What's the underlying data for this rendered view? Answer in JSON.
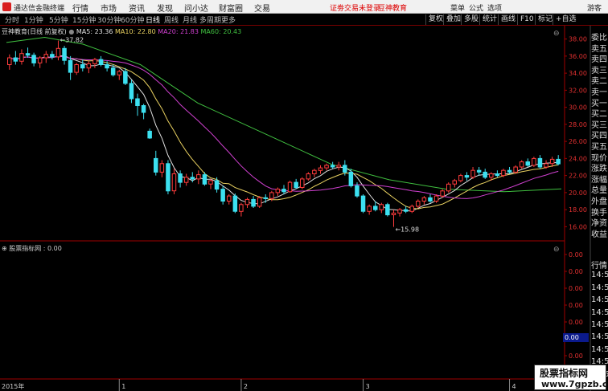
{
  "app": {
    "title": "通达信金融终端",
    "notice": "证劵交易未登录",
    "brand": "豆神教育",
    "user": "游客"
  },
  "menu": [
    "行情",
    "市场",
    "资讯",
    "发现",
    "问小达",
    "财富圈",
    "交易"
  ],
  "right_menu": [
    "菜单",
    "公式",
    "选项"
  ],
  "timeframes": [
    "分时",
    "1分钟",
    "5分钟",
    "15分钟",
    "30分钟",
    "60分钟",
    "日线",
    "周线",
    "月线",
    "多周期",
    "更多"
  ],
  "active_timeframe": "日线",
  "tools": [
    "复权",
    "叠加",
    "多股",
    "统计",
    "画线",
    "F10",
    "标记",
    "+自选"
  ],
  "chart": {
    "stock": "豆神教育(日线 前复权)",
    "ma5": "MA5: 23.36",
    "ma10": "MA10: 22.80",
    "ma20": "MA20: 21.83",
    "ma60": "MA60: 20.43",
    "high_label": "37.82",
    "low_label": "15.98",
    "indicator": "股票指标网 : 0.00",
    "year_label": "2015年",
    "months": [
      "1",
      "2",
      "3",
      "4"
    ],
    "value_box": "0.00"
  },
  "colors": {
    "up": "#ff3c3c",
    "down": "#3ce0f0",
    "ma5": "#e0e0e0",
    "ma10": "#e8d060",
    "ma20": "#d040d0",
    "ma60": "#40c040",
    "axis": "#a00000"
  },
  "right_panel": {
    "items": [
      "委比",
      "卖五",
      "卖四",
      "卖三",
      "卖二",
      "卖一",
      "买一",
      "买二",
      "买三",
      "买四",
      "买五",
      "现价",
      "涨跌",
      "涨幅",
      "总量",
      "外盘",
      "换手",
      "净资",
      "收益"
    ],
    "lower": [
      "行情",
      "14:5",
      "14:5",
      "14:5",
      "14:5",
      "14:5",
      "14:5",
      "14:5",
      "14:5",
      "14:5"
    ]
  },
  "watermark": {
    "line1": "股票指标网",
    "line2": "www.7gpzb.com"
  },
  "chart_data": {
    "type": "candlestick",
    "ylim": [
      15,
      39
    ],
    "yticks": [
      16,
      18,
      20,
      22,
      24,
      26,
      28,
      30,
      32,
      34,
      36,
      38
    ],
    "indicator_yticks": [
      "0.00",
      "0.00",
      "0.00",
      "0.00",
      "0.00",
      "0.00",
      "0.00",
      "0.00"
    ],
    "candles": [
      [
        35.0,
        36.2,
        34.4,
        35.8
      ],
      [
        35.8,
        36.6,
        35.0,
        35.4
      ],
      [
        35.4,
        36.8,
        35.0,
        36.3
      ],
      [
        36.3,
        37.0,
        35.8,
        36.1
      ],
      [
        36.1,
        36.4,
        34.8,
        35.2
      ],
      [
        35.2,
        36.0,
        34.6,
        35.8
      ],
      [
        35.8,
        36.6,
        35.2,
        36.2
      ],
      [
        36.2,
        36.6,
        35.6,
        35.9
      ],
      [
        35.9,
        37.82,
        35.5,
        36.9
      ],
      [
        36.9,
        37.2,
        35.0,
        35.5
      ],
      [
        35.5,
        36.0,
        33.2,
        34.1
      ],
      [
        34.1,
        35.2,
        33.8,
        35.0
      ],
      [
        35.0,
        35.6,
        34.2,
        34.6
      ],
      [
        34.6,
        35.4,
        34.0,
        35.1
      ],
      [
        35.1,
        35.8,
        34.6,
        35.6
      ],
      [
        35.6,
        36.0,
        34.8,
        35.0
      ],
      [
        35.0,
        35.4,
        34.2,
        34.6
      ],
      [
        34.6,
        35.0,
        33.6,
        33.8
      ],
      [
        33.8,
        34.4,
        33.2,
        34.2
      ],
      [
        34.2,
        34.6,
        32.6,
        32.8
      ],
      [
        32.8,
        33.2,
        30.5,
        31.0
      ],
      [
        31.0,
        31.6,
        29.0,
        30.2
      ],
      [
        30.2,
        30.4,
        28.6,
        29.4
      ],
      [
        27.2,
        27.5,
        26.3,
        26.4
      ],
      [
        24.0,
        24.9,
        22.0,
        22.4
      ],
      [
        22.4,
        23.8,
        21.8,
        23.4
      ],
      [
        23.4,
        23.8,
        19.8,
        20.2
      ],
      [
        20.2,
        22.8,
        19.8,
        22.2
      ],
      [
        22.2,
        22.6,
        20.6,
        21.2
      ],
      [
        21.2,
        22.2,
        20.8,
        21.8
      ],
      [
        21.8,
        22.4,
        21.2,
        21.6
      ],
      [
        21.6,
        22.6,
        21.0,
        22.1
      ],
      [
        22.1,
        22.4,
        20.8,
        21.0
      ],
      [
        21.0,
        21.6,
        20.4,
        21.4
      ],
      [
        21.4,
        21.8,
        20.0,
        20.4
      ],
      [
        20.4,
        20.8,
        18.6,
        19.0
      ],
      [
        19.0,
        19.8,
        18.6,
        19.6
      ],
      [
        19.6,
        19.9,
        17.6,
        17.8
      ],
      [
        17.8,
        18.8,
        17.2,
        18.6
      ],
      [
        18.6,
        19.4,
        18.2,
        19.2
      ],
      [
        19.2,
        19.6,
        18.2,
        18.4
      ],
      [
        18.4,
        19.6,
        18.2,
        19.4
      ],
      [
        19.4,
        19.8,
        18.8,
        19.3
      ],
      [
        19.3,
        20.2,
        19.0,
        20.0
      ],
      [
        20.0,
        20.6,
        19.6,
        20.4
      ],
      [
        20.4,
        20.9,
        19.8,
        20.1
      ],
      [
        20.1,
        21.4,
        20.0,
        21.2
      ],
      [
        21.2,
        21.6,
        20.4,
        20.6
      ],
      [
        20.6,
        21.8,
        20.4,
        21.6
      ],
      [
        21.6,
        22.4,
        21.4,
        22.2
      ],
      [
        22.2,
        22.8,
        21.8,
        22.6
      ],
      [
        22.6,
        23.2,
        22.2,
        22.9
      ],
      [
        22.9,
        23.4,
        22.6,
        23.2
      ],
      [
        23.2,
        23.6,
        22.8,
        23.0
      ],
      [
        23.0,
        23.6,
        22.6,
        23.2
      ],
      [
        23.2,
        23.8,
        22.0,
        22.4
      ],
      [
        22.4,
        22.8,
        20.6,
        20.8
      ],
      [
        20.8,
        21.2,
        19.4,
        19.6
      ],
      [
        19.6,
        19.8,
        17.6,
        17.8
      ],
      [
        17.8,
        18.6,
        17.4,
        18.4
      ],
      [
        18.4,
        19.0,
        17.8,
        18.0
      ],
      [
        18.0,
        18.8,
        17.6,
        18.6
      ],
      [
        18.6,
        18.8,
        17.2,
        17.4
      ],
      [
        17.4,
        18.0,
        15.98,
        17.6
      ],
      [
        17.6,
        18.2,
        17.2,
        18.0
      ],
      [
        18.0,
        18.4,
        17.6,
        17.8
      ],
      [
        17.8,
        18.6,
        17.6,
        18.4
      ],
      [
        18.4,
        19.2,
        18.2,
        19.0
      ],
      [
        19.0,
        19.6,
        18.6,
        19.4
      ],
      [
        19.4,
        19.8,
        18.8,
        19.0
      ],
      [
        19.0,
        19.8,
        18.8,
        19.6
      ],
      [
        19.6,
        20.4,
        19.4,
        20.2
      ],
      [
        20.2,
        21.2,
        20.0,
        21.0
      ],
      [
        21.0,
        21.6,
        20.6,
        21.4
      ],
      [
        21.4,
        22.2,
        21.2,
        22.0
      ],
      [
        22.0,
        22.4,
        21.4,
        21.8
      ],
      [
        21.8,
        23.0,
        21.6,
        22.6
      ],
      [
        22.6,
        23.0,
        22.0,
        22.4
      ],
      [
        22.4,
        22.8,
        21.6,
        21.8
      ],
      [
        21.8,
        22.4,
        21.4,
        22.2
      ],
      [
        22.2,
        22.6,
        21.8,
        22.0
      ],
      [
        22.0,
        22.8,
        21.8,
        22.6
      ],
      [
        22.6,
        23.0,
        22.2,
        22.4
      ],
      [
        22.4,
        23.2,
        22.2,
        23.0
      ],
      [
        23.0,
        23.8,
        22.8,
        23.6
      ],
      [
        23.6,
        24.0,
        23.0,
        23.2
      ],
      [
        23.2,
        24.2,
        23.0,
        24.0
      ],
      [
        24.0,
        24.4,
        22.8,
        23.0
      ],
      [
        23.0,
        23.8,
        22.8,
        23.4
      ],
      [
        23.4,
        24.2,
        23.0,
        23.9
      ],
      [
        23.9,
        24.4,
        23.2,
        23.36
      ]
    ],
    "ma60_points": [
      [
        0,
        37.6
      ],
      [
        10,
        38.2
      ],
      [
        20,
        37.4
      ],
      [
        35,
        35.0
      ],
      [
        50,
        30.5
      ],
      [
        70,
        26.4
      ],
      [
        85,
        23.3
      ],
      [
        100,
        21.5
      ],
      [
        115,
        20.4
      ],
      [
        130,
        20.1
      ],
      [
        145,
        20.43
      ]
    ],
    "month_ticks": [
      [
        18,
        "1"
      ],
      [
        38,
        "2"
      ],
      [
        58,
        "3"
      ],
      [
        82,
        "4"
      ]
    ]
  }
}
